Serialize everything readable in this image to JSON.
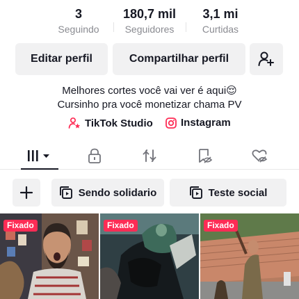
{
  "stats": [
    {
      "value": "3",
      "label": "Seguindo"
    },
    {
      "value": "180,7 mil",
      "label": "Seguidores"
    },
    {
      "value": "3,1 mi",
      "label": "Curtidas"
    }
  ],
  "actions": {
    "edit_label": "Editar perfil",
    "share_label": "Compartilhar perfil"
  },
  "bio": {
    "line1": "Melhores cortes você vai ver é aqui😌",
    "line2": "Cursinho pra você monetizar chama PV"
  },
  "links": [
    {
      "label": "TikTok Studio",
      "icon": "person-star-icon"
    },
    {
      "label": "Instagram",
      "icon": "instagram-icon"
    }
  ],
  "tabs": [
    {
      "name": "videos-grid",
      "icon": "grid-bars-icon",
      "active": true
    },
    {
      "name": "private",
      "icon": "lock-icon"
    },
    {
      "name": "reposts",
      "icon": "repost-icon"
    },
    {
      "name": "saved",
      "icon": "bookmark-eye-icon"
    },
    {
      "name": "liked",
      "icon": "heart-eye-icon"
    }
  ],
  "folders": [
    {
      "label": "Sendo solidario"
    },
    {
      "label": "Teste social"
    }
  ],
  "videos": [
    {
      "badge": "Fixado"
    },
    {
      "badge": "Fixado"
    },
    {
      "badge": "Fixado"
    }
  ],
  "colors": {
    "accent": "#fe2c55",
    "text": "#161823",
    "muted": "#8a8b91",
    "button_bg": "#f1f1f2"
  }
}
